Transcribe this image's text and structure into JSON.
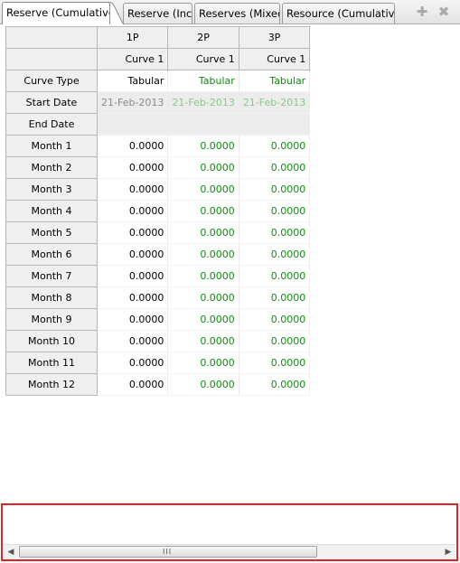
{
  "tabs": [
    {
      "label": "Reserve (Cumulative)",
      "active": true
    },
    {
      "label": "Reserve (Incr)",
      "active": false
    },
    {
      "label": "Reserves (Mixed)",
      "active": false
    },
    {
      "label": "Resource (Cumulative)",
      "active": false
    }
  ],
  "toolbar": {
    "add_icon": "plus-icon",
    "close_icon": "close-icon"
  },
  "grid": {
    "columns": [
      "1P",
      "2P",
      "3P"
    ],
    "curve_names": [
      "Curve 1",
      "Curve 1",
      "Curve 1"
    ],
    "curve_type": {
      "label": "Curve Type",
      "values": [
        "Tabular",
        "Tabular",
        "Tabular"
      ]
    },
    "start_date": {
      "label": "Start Date",
      "values": [
        "21-Feb-2013",
        "21-Feb-2013",
        "21-Feb-2013"
      ]
    },
    "end_date": {
      "label": "End Date",
      "values": [
        "",
        "",
        ""
      ]
    },
    "months": [
      {
        "label": "Month 1",
        "values": [
          "0.0000",
          "0.0000",
          "0.0000"
        ]
      },
      {
        "label": "Month 2",
        "values": [
          "0.0000",
          "0.0000",
          "0.0000"
        ]
      },
      {
        "label": "Month 3",
        "values": [
          "0.0000",
          "0.0000",
          "0.0000"
        ]
      },
      {
        "label": "Month 4",
        "values": [
          "0.0000",
          "0.0000",
          "0.0000"
        ]
      },
      {
        "label": "Month 5",
        "values": [
          "0.0000",
          "0.0000",
          "0.0000"
        ]
      },
      {
        "label": "Month 6",
        "values": [
          "0.0000",
          "0.0000",
          "0.0000"
        ]
      },
      {
        "label": "Month 7",
        "values": [
          "0.0000",
          "0.0000",
          "0.0000"
        ]
      },
      {
        "label": "Month 8",
        "values": [
          "0.0000",
          "0.0000",
          "0.0000"
        ]
      },
      {
        "label": "Month 9",
        "values": [
          "0.0000",
          "0.0000",
          "0.0000"
        ]
      },
      {
        "label": "Month 10",
        "values": [
          "0.0000",
          "0.0000",
          "0.0000"
        ]
      },
      {
        "label": "Month 11",
        "values": [
          "0.0000",
          "0.0000",
          "0.0000"
        ]
      },
      {
        "label": "Month 12",
        "values": [
          "0.0000",
          "0.0000",
          "0.0000"
        ]
      }
    ]
  },
  "colors": {
    "value_green": "#118a11",
    "highlight_border": "#e0222b"
  },
  "scrollbar": {
    "grip": "III"
  }
}
